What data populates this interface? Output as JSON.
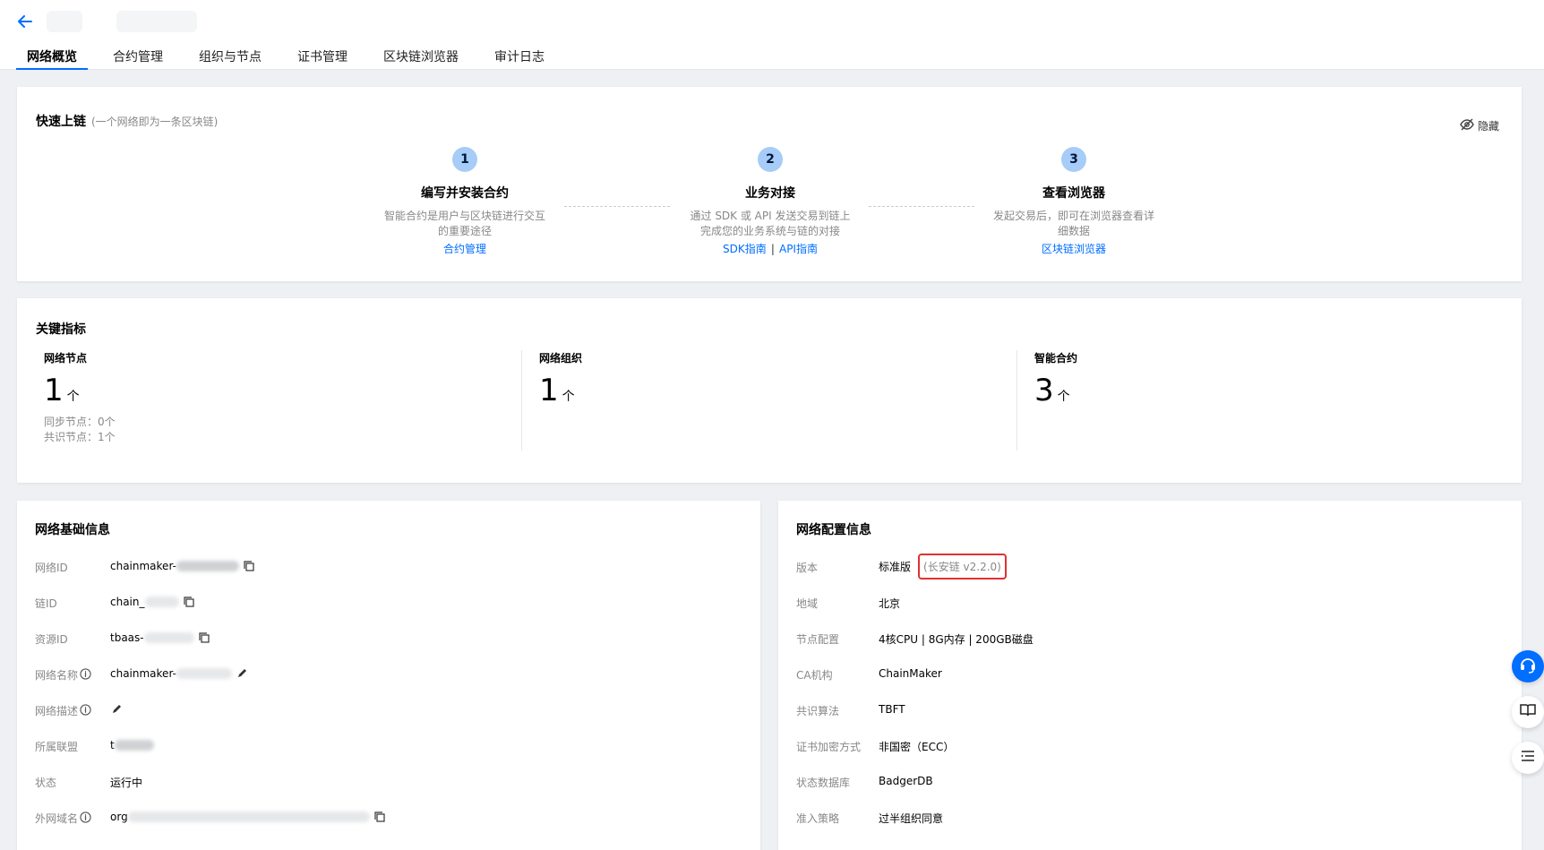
{
  "tabs": [
    {
      "label": "网络概览",
      "active": true
    },
    {
      "label": "合约管理",
      "active": false
    },
    {
      "label": "组织与节点",
      "active": false
    },
    {
      "label": "证书管理",
      "active": false
    },
    {
      "label": "区块链浏览器",
      "active": false
    },
    {
      "label": "审计日志",
      "active": false
    }
  ],
  "quick": {
    "title": "快速上链",
    "subtitle": "(一个网络即为一条区块链)",
    "hide_label": "隐藏",
    "steps": [
      {
        "num": "1",
        "title": "编写并安装合约",
        "desc": "智能合约是用户与区块链进行交互的重要途径",
        "link1": "合约管理"
      },
      {
        "num": "2",
        "title": "业务对接",
        "desc": "通过 SDK 或 API 发送交易到链上完成您的业务系统与链的对接",
        "link1": "SDK指南",
        "sep": "|",
        "link2": "API指南"
      },
      {
        "num": "3",
        "title": "查看浏览器",
        "desc": "发起交易后，即可在浏览器查看详细数据",
        "link1": "区块链浏览器"
      }
    ]
  },
  "metrics": {
    "title": "关键指标",
    "items": [
      {
        "label": "网络节点",
        "value": "1",
        "unit": "个",
        "sub1": "同步节点：0个",
        "sub2": "共识节点：1个"
      },
      {
        "label": "网络组织",
        "value": "1",
        "unit": "个"
      },
      {
        "label": "智能合约",
        "value": "3",
        "unit": "个"
      }
    ]
  },
  "basic": {
    "title": "网络基础信息",
    "labels": {
      "network_id": "网络ID",
      "chain_id": "链ID",
      "resource_id": "资源ID",
      "network_name": "网络名称",
      "network_desc": "网络描述",
      "alliance": "所属联盟",
      "status": "状态",
      "domain": "外网域名"
    },
    "values": {
      "network_id": "chainmaker-",
      "chain_id": "chain_",
      "resource_id": "tbaas-",
      "network_name": "chainmaker-",
      "alliance": "t",
      "status": "运行中",
      "domain": "org"
    }
  },
  "config": {
    "title": "网络配置信息",
    "rows": [
      {
        "label": "版本",
        "value": "标准版",
        "extra": "(长安链 v2.2.0)"
      },
      {
        "label": "地域",
        "value": "北京"
      },
      {
        "label": "节点配置",
        "value": "4核CPU | 8G内存 | 200GB磁盘"
      },
      {
        "label": "CA机构",
        "value": "ChainMaker"
      },
      {
        "label": "共识算法",
        "value": "TBFT"
      },
      {
        "label": "证书加密方式",
        "value": "非国密（ECC）"
      },
      {
        "label": "状态数据库",
        "value": "BadgerDB"
      },
      {
        "label": "准入策略",
        "value": "过半组织同意"
      }
    ]
  },
  "colors": {
    "accent": "#006eff",
    "highlight": "#e03131"
  }
}
